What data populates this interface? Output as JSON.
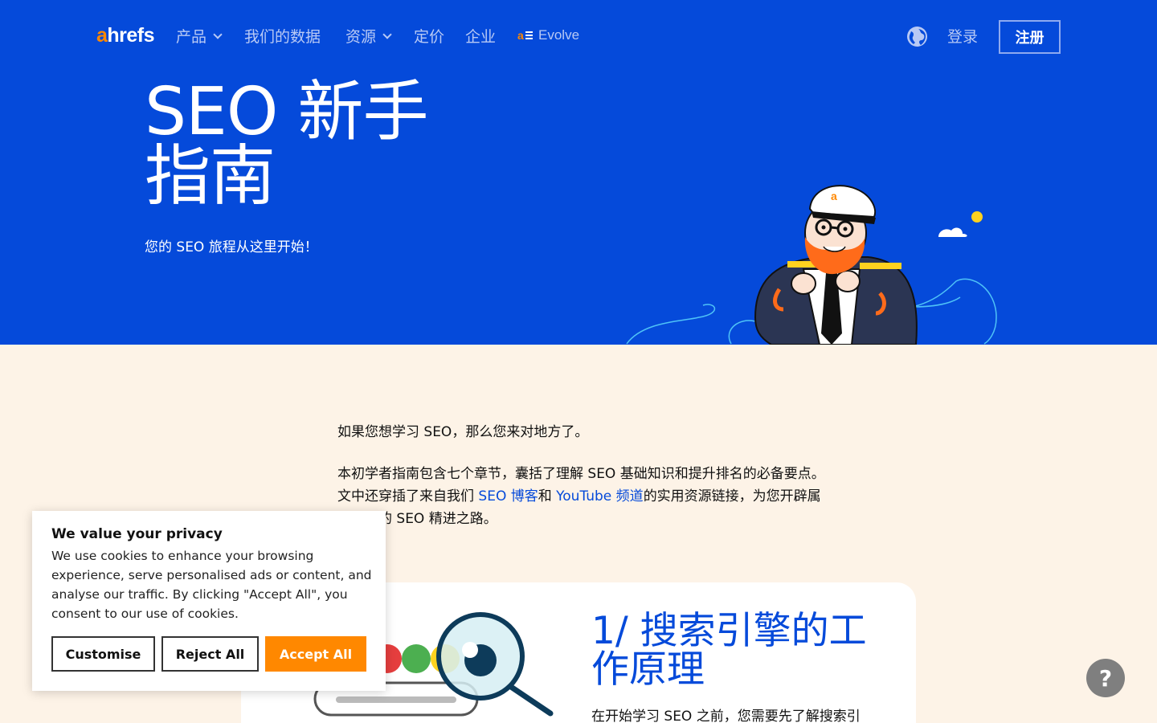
{
  "colors": {
    "brand_blue": "#054ADA",
    "accent_orange": "#ff8800",
    "page_bg": "#fdf3e7"
  },
  "nav": {
    "logo_a": "a",
    "logo_rest": "hrefs",
    "items": [
      {
        "label": "产品",
        "has_dropdown": true
      },
      {
        "label": "我们的数据",
        "has_dropdown": false
      },
      {
        "label": "资源",
        "has_dropdown": true
      },
      {
        "label": "定价",
        "has_dropdown": false
      },
      {
        "label": "企业",
        "has_dropdown": false
      }
    ],
    "evolve_label": "Evolve",
    "globe_icon": "globe-icon",
    "login_label": "登录",
    "signup_label": "注册"
  },
  "hero": {
    "title": "SEO 新手指南",
    "subtitle": "您的 SEO 旅程从这里开始！"
  },
  "intro": {
    "p1": "如果您想学习 SEO，那么您来对地方了。",
    "p2_part1": "本初学者指南包含七个章节，囊括了理解 SEO 基础知识和提升排名的必备要点。文中还穿插了来自我们 ",
    "p2_link1": "SEO 博客",
    "p2_part2": "和 ",
    "p2_link2": "YouTube 频道",
    "p2_part3": "的实用资源链接，为您开辟属于自己的 SEO 精进之路。"
  },
  "chapter": {
    "title": "1/ 搜索引擎的工作原理",
    "text": "在开始学习 SEO 之前，您需要先了解搜索引"
  },
  "cookie": {
    "title": "We value your privacy",
    "text": "We use cookies to enhance your browsing experience, serve personalised ads or content, and analyse our traffic. By clicking \"Accept All\", you consent to our use of cookies.",
    "customise_label": "Customise",
    "reject_label": "Reject All",
    "accept_label": "Accept All"
  },
  "help": {
    "label": "?"
  }
}
